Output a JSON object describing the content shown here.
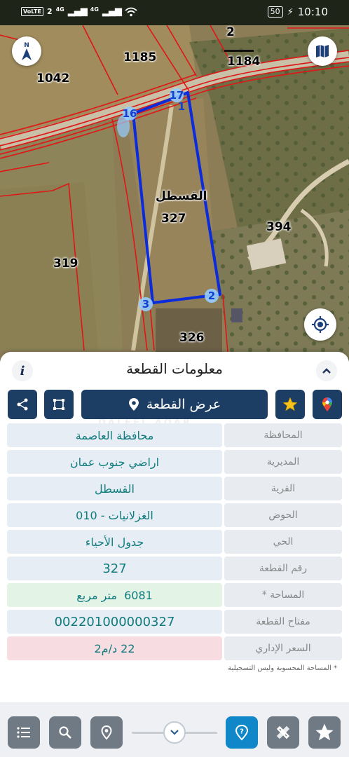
{
  "status_bar": {
    "network_badge": "VoLTE",
    "sim_label": "2",
    "signal_1": "4G",
    "signal_2": "4G",
    "battery": "50",
    "time": "10:10"
  },
  "map": {
    "parcel_numbers": {
      "top_center": "2",
      "top_right": "1184",
      "top_left": "1185",
      "left_upper": "1042",
      "left_lower": "319",
      "selected": "327",
      "bottom": "326",
      "right": "394"
    },
    "village_label": "القسطل",
    "vertices": [
      "17",
      "1",
      "16",
      "3",
      "2"
    ],
    "boundary_color": "#0b2bdc",
    "cadastre_line_color": "#e01616",
    "icons": {
      "compass": "north-arrow-icon",
      "layers": "map-layers-icon",
      "locate": "gps-locate-icon"
    }
  },
  "panel": {
    "title": "معلومات القطعة",
    "info_icon": "i",
    "show_parcel_label": "عرض القطعة",
    "watermark": "DALEEL AQAR",
    "rows": [
      {
        "label": "المحافظة",
        "value": "محافظة العاصمة"
      },
      {
        "label": "المديرية",
        "value": "اراضي جنوب عمان"
      },
      {
        "label": "القرية",
        "value": "القسطل"
      },
      {
        "label": "الحوض",
        "value": "الغزلانيات - 010"
      },
      {
        "label": "الحي",
        "value": "جدول الأحياء"
      },
      {
        "label": "رقم القطعة",
        "value": "327"
      },
      {
        "label": "المساحة *",
        "value": "6081  متر مربع"
      },
      {
        "label": "مفتاح القطعة",
        "value": "002201000000327"
      },
      {
        "label": "السعر الإداري",
        "value": "22 د/م2"
      }
    ],
    "footnote": "* المساحة المحسوبة وليس التسجيلية",
    "colors": {
      "accent": "#1c3d64",
      "value_text": "#0f7b7d",
      "area_bg": "#e3f4e7",
      "price_bg": "#f7dde1"
    }
  },
  "toolbar": {
    "icons": [
      "list-icon",
      "search-icon",
      "location-pin-icon",
      "chevron-down-icon",
      "help-icon",
      "measure-icon",
      "star-icon"
    ],
    "active": "help-icon",
    "active_color": "#1087c8"
  }
}
